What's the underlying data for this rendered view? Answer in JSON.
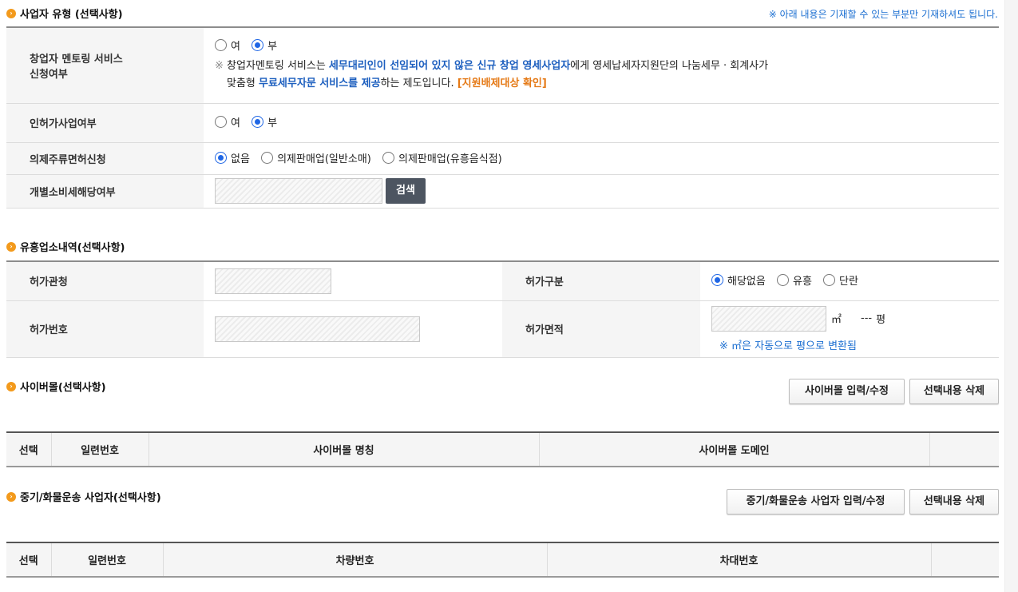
{
  "biz_type": {
    "title": "사업자 유형 (선택사항)",
    "note": "※ 아래 내용은 기재할 수 있는 부분만 기재하셔도 됩니다.",
    "mentoring": {
      "label_line1": "창업자 멘토링 서비스",
      "label_line2": "신청여부",
      "opt_yes": "여",
      "opt_no": "부",
      "selected": "부",
      "note_mark": "※",
      "note_p1": "창업자멘토링 서비스는 ",
      "note_p2": "세무대리인이 선임되어 있지 않은 신규 창업 영세사업자",
      "note_p3": "에게 영세납세자지원단의 나눔세무 · 회계사가",
      "note_p4": "맞춤형 ",
      "note_p5": "무료세무자문 서비스를 제공",
      "note_p6": "하는 제도입니다. ",
      "note_p7": "[지원배제대상 확인]"
    },
    "license": {
      "label": "인허가사업여부",
      "opt_yes": "여",
      "opt_no": "부",
      "selected": "부"
    },
    "liquor": {
      "label": "의제주류면허신청",
      "opt1": "없음",
      "opt2": "의제판매업(일반소매)",
      "opt3": "의제판매업(유흥음식점)",
      "selected": "없음"
    },
    "excise": {
      "label": "개별소비세해당여부",
      "search_btn": "검색"
    }
  },
  "entertainment": {
    "title": "유흥업소내역(선택사항)",
    "authority_label": "허가관청",
    "type_label": "허가구분",
    "type_opt1": "해당없음",
    "type_opt2": "유흥",
    "type_opt3": "단란",
    "type_selected": "해당없음",
    "number_label": "허가번호",
    "area_label": "허가면적",
    "area_unit": "㎡",
    "pyeong_value": "---",
    "pyeong_unit": "평",
    "area_note": "※ ㎡은 자동으로 평으로 변환됨"
  },
  "cybermall": {
    "title": "사이버몰(선택사항)",
    "btn_edit": "사이버몰 입력/수정",
    "btn_delete": "선택내용 삭제",
    "columns": [
      "선택",
      "일련번호",
      "사이버몰 명칭",
      "사이버몰 도메인",
      ""
    ]
  },
  "freight": {
    "title": "중기/화물운송 사업자(선택사항)",
    "btn_edit": "중기/화물운송 사업자 입력/수정",
    "btn_delete": "선택내용 삭제",
    "columns": [
      "선택",
      "일련번호",
      "차량번호",
      "차대번호",
      ""
    ]
  },
  "colors": {
    "accent_blue": "#1d5fbf",
    "note_orange": "#e57a17",
    "radio_blue": "#1f66e5",
    "bullet_orange": "#f39a1c",
    "dark_button": "#4d5561"
  }
}
